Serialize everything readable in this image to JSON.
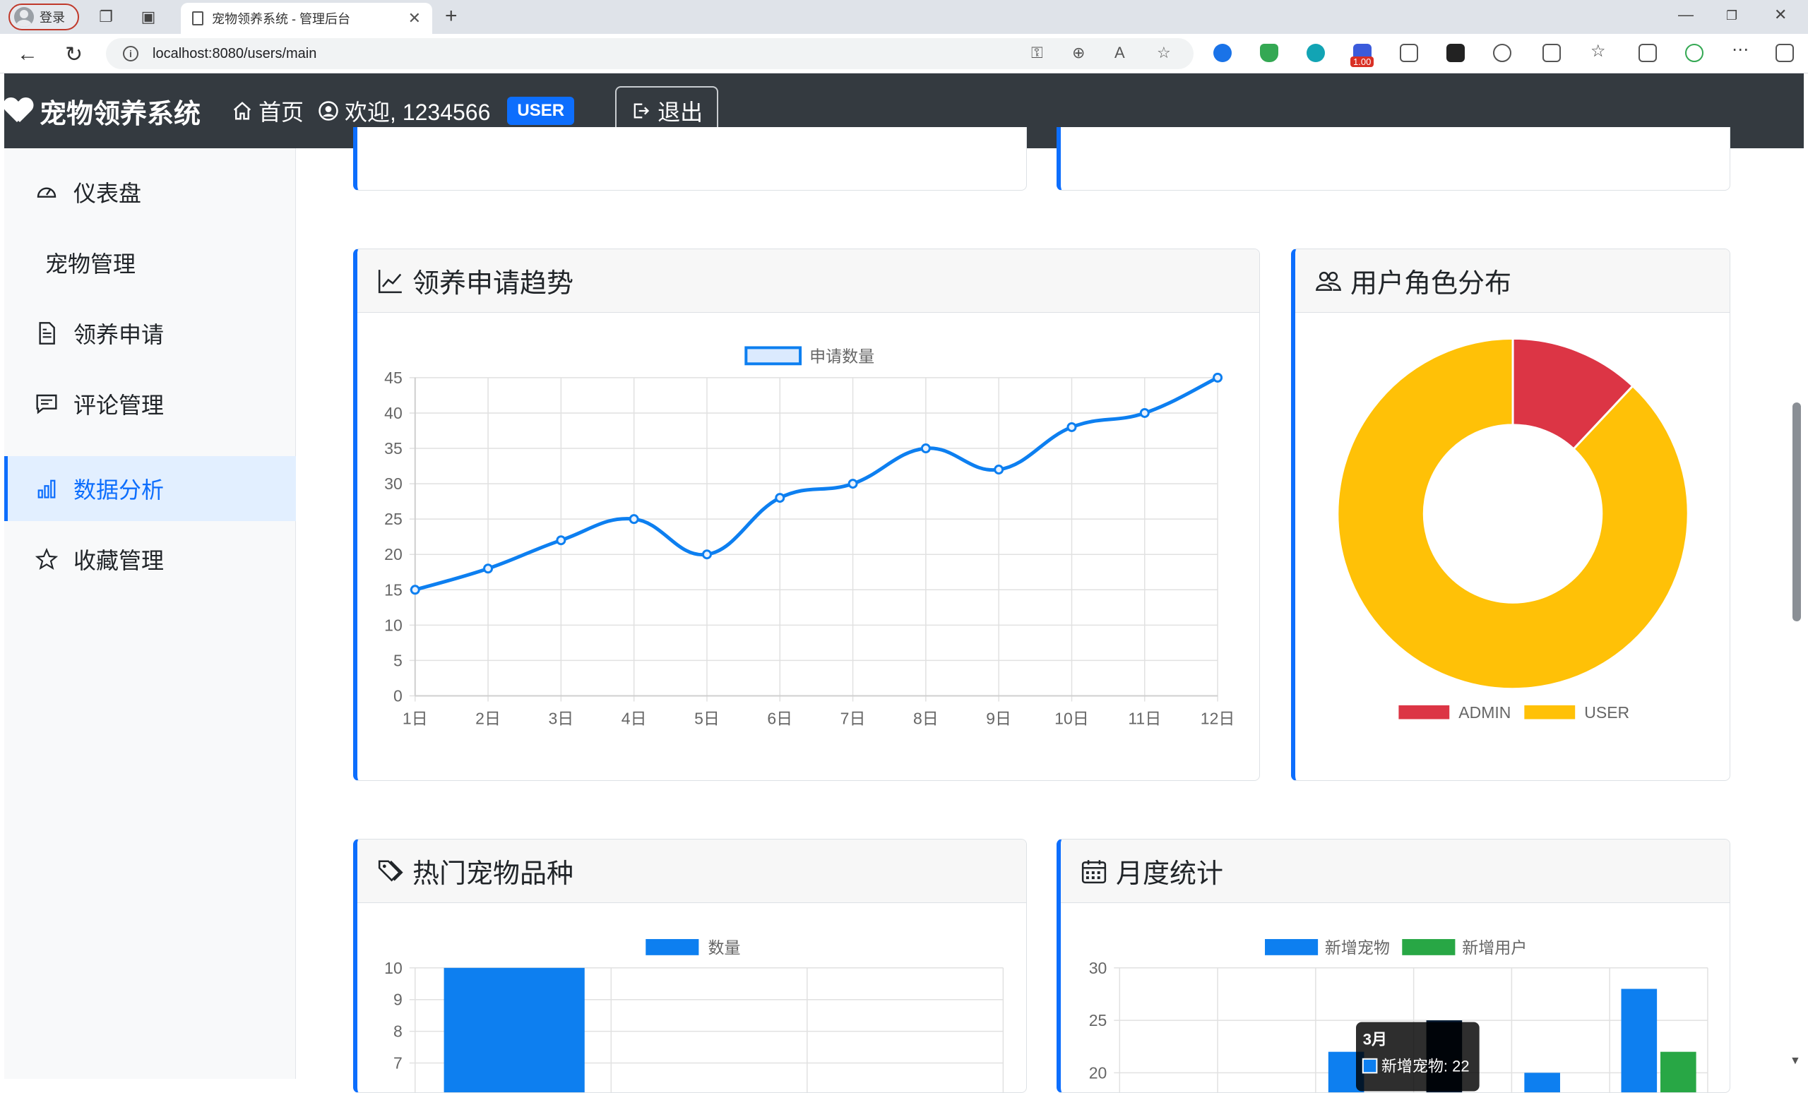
{
  "browser": {
    "profile_label": "登录",
    "tab_title": "宠物领养系统 - 管理后台",
    "url": "localhost:8080/users/main",
    "ext_badge": "1.00"
  },
  "header": {
    "brand": "宠物领养系统",
    "home": "首页",
    "welcome": "欢迎, 1234566",
    "role": "USER",
    "logout": "退出"
  },
  "sidebar": {
    "items": [
      {
        "label": "仪表盘",
        "icon": "speedometer-icon"
      },
      {
        "label": "宠物管理",
        "icon": ""
      },
      {
        "label": "领养申请",
        "icon": "document-icon"
      },
      {
        "label": "评论管理",
        "icon": "comment-icon"
      },
      {
        "label": "数据分析",
        "icon": "bar-chart-icon",
        "active": true
      },
      {
        "label": "收藏管理",
        "icon": "star-icon"
      }
    ]
  },
  "cards": {
    "trend_title": "领养申请趋势",
    "roles_title": "用户角色分布",
    "breeds_title": "热门宠物品种",
    "monthly_title": "月度统计"
  },
  "chart_data": [
    {
      "type": "line",
      "legend": [
        "申请数量"
      ],
      "categories": [
        "1日",
        "2日",
        "3日",
        "4日",
        "5日",
        "6日",
        "7日",
        "8日",
        "9日",
        "10日",
        "11日",
        "12日"
      ],
      "series": [
        {
          "name": "申请数量",
          "values": [
            15,
            18,
            22,
            25,
            20,
            28,
            30,
            35,
            32,
            38,
            40,
            45
          ],
          "color": "#0d7ff0"
        }
      ],
      "yticks": [
        0,
        5,
        10,
        15,
        20,
        25,
        30,
        35,
        40,
        45
      ],
      "ylim": [
        0,
        45
      ],
      "grid": true
    },
    {
      "type": "pie",
      "labels": [
        "ADMIN",
        "USER"
      ],
      "values": [
        12,
        88
      ],
      "colors": [
        "#dc3545",
        "#ffc107"
      ],
      "legend": "bottom"
    },
    {
      "type": "bar",
      "legend": [
        "数量"
      ],
      "series": [
        {
          "name": "数量",
          "values": [
            10
          ],
          "color": "#0d7ff0"
        }
      ],
      "yticks": [
        7,
        8,
        9,
        10
      ],
      "ylim": [
        0,
        10
      ]
    },
    {
      "type": "bar",
      "legend": [
        "新增宠物",
        "新增用户"
      ],
      "yticks": [
        20,
        25,
        30
      ],
      "series": [
        {
          "name": "新增宠物",
          "color": "#0d7ff0",
          "values": [
            22,
            20,
            28
          ]
        },
        {
          "name": "新增用户",
          "color": "#28a745",
          "values": [
            25,
            22
          ]
        }
      ],
      "tooltip": {
        "title": "3月",
        "line": "新增宠物: 22"
      }
    }
  ]
}
